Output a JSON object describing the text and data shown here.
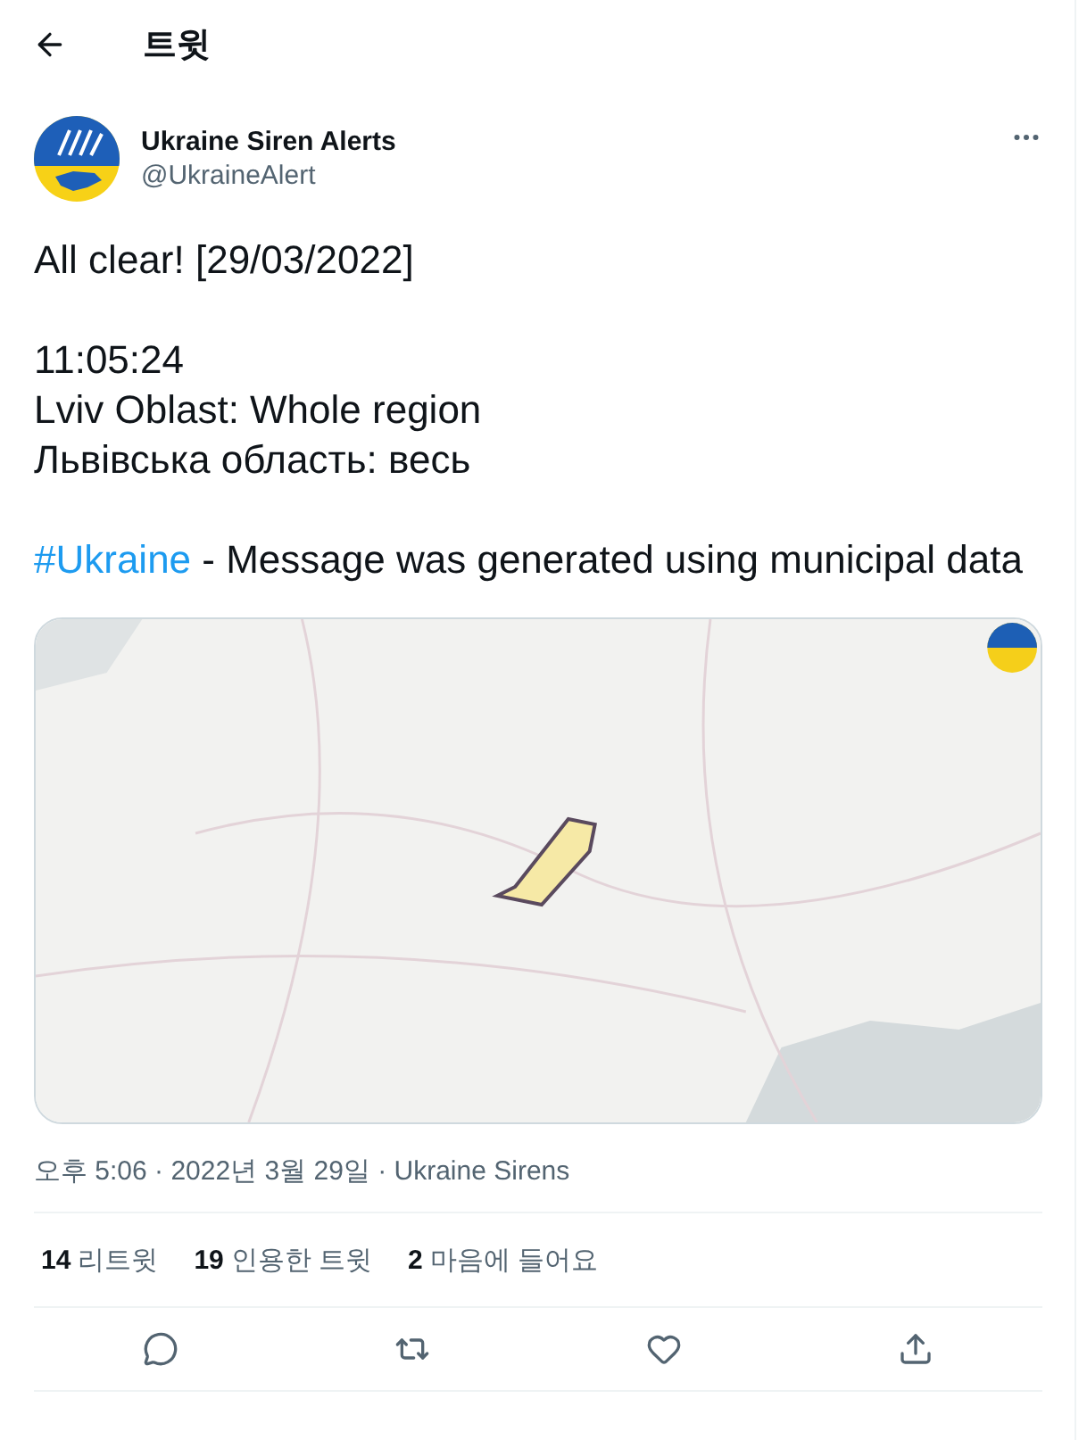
{
  "header": {
    "title": "트윗"
  },
  "author": {
    "name": "Ukraine Siren Alerts",
    "handle": "@UkraineAlert"
  },
  "body": [
    {
      "kind": "lines",
      "lines": [
        "All clear! [29/03/2022]"
      ]
    },
    {
      "kind": "lines",
      "lines": [
        "11:05:24",
        "Lviv Oblast: Whole region",
        "Львівська область: весь"
      ]
    },
    {
      "kind": "hashtag",
      "tag": "#Ukraine",
      "text": " - Message was generated using municipal data"
    }
  ],
  "meta": {
    "time": "오후 5:06 · 2022년 3월 29일 · ",
    "source": "Ukraine Sirens"
  },
  "stats": [
    {
      "count": "14",
      "label": "리트윗"
    },
    {
      "count": "19",
      "label": "인용한 트윗"
    },
    {
      "count": "2",
      "label": "마음에 들어요"
    }
  ],
  "actions": [
    {
      "kind": "reply"
    },
    {
      "kind": "retweet"
    },
    {
      "kind": "like"
    },
    {
      "kind": "share"
    }
  ]
}
